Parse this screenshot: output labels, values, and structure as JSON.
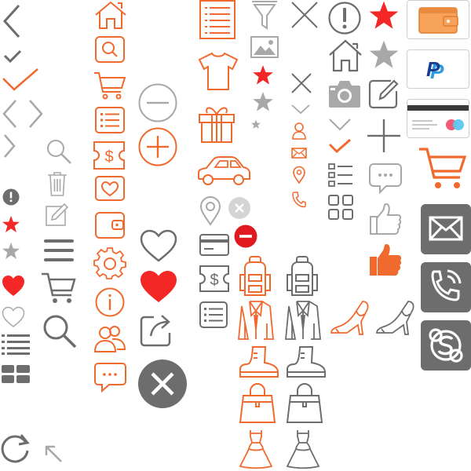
{
  "palette": {
    "orange": "#f06a2e",
    "gray": "#6d6d6d",
    "light_gray": "#a8a8a8",
    "red": "#f42727",
    "tile_gray": "#6d6d6d",
    "wallet_orange": "#f7a35c",
    "paypal_blue": "#1a3e8f",
    "paypal_light": "#2b9be0"
  },
  "icons": [
    "chevron-left-icon",
    "check-icon",
    "checkmark-orange-icon",
    "code-brackets-icon",
    "chevron-right-icon",
    "alert-icon",
    "star-icon",
    "heart-icon",
    "menu-icon",
    "grid-icon",
    "refresh-icon",
    "arrow-up-left-icon",
    "search-icon",
    "trash-icon",
    "edit-icon",
    "cart-icon",
    "magnifier-icon",
    "home-icon",
    "search-doc-icon",
    "cart-icon",
    "list-icon",
    "ticket-icon",
    "heart-box-icon",
    "wallet-icon",
    "settings-icon",
    "info-icon",
    "users-icon",
    "chat-icon",
    "minus-circle-icon",
    "plus-circle-icon",
    "heart-outline-icon",
    "heart-filled-icon",
    "share-icon",
    "close-circle-icon",
    "document-icon",
    "tshirt-icon",
    "gift-icon",
    "car-icon",
    "location-pin-icon",
    "card-icon",
    "ticket-icon",
    "list-icon",
    "filter-icon",
    "image-icon",
    "star-icon",
    "close-icon",
    "user-icon",
    "mail-icon",
    "phone-icon",
    "backpack-icon",
    "jacket-icon",
    "boot-icon",
    "handbag-icon",
    "dress-icon",
    "high-heel-icon",
    "exclamation-circle-icon",
    "home-icon",
    "camera-icon",
    "chevron-down-icon",
    "list-check-icon",
    "tiles-icon",
    "star-icon",
    "edit-icon",
    "plus-icon",
    "chat-bubble-icon",
    "thumbs-up-icon",
    "wallet-card-icon",
    "paypal-icon",
    "credit-card-icon",
    "shopping-cart-icon",
    "email-tile-icon",
    "phone-tile-icon",
    "skype-tile-icon"
  ],
  "payment": {
    "paypal_letter": "P"
  }
}
